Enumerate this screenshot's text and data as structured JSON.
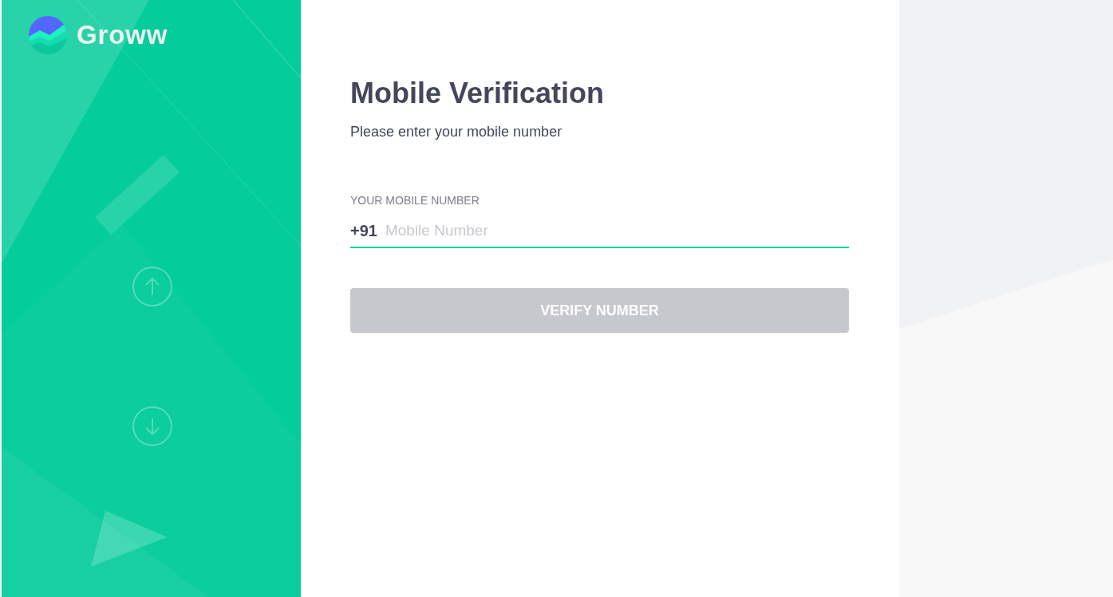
{
  "brand": {
    "name": "Groww"
  },
  "form": {
    "title": "Mobile Verification",
    "subtitle": "Please enter your mobile number",
    "field_label": "YOUR MOBILE NUMBER",
    "country_code": "+91",
    "placeholder": "Mobile Number"
  },
  "verify_button": {
    "label": "VERIFY NUMBER",
    "disabled": true
  }
}
